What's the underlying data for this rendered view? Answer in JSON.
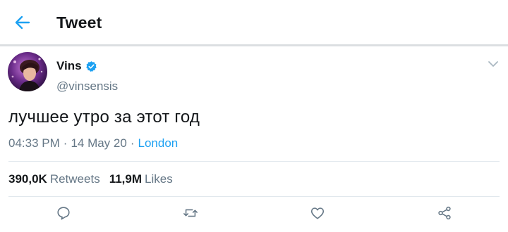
{
  "header": {
    "title": "Tweet",
    "back_icon": "arrow-left-icon",
    "accent_color": "#1da1f2"
  },
  "tweet": {
    "author": {
      "name": "Vins",
      "handle": "@vinsensis",
      "verified": true
    },
    "text": "лучшее утро за этот год",
    "time": "04:33 PM",
    "separator": "·",
    "date": "14 May 20",
    "location": "London",
    "stats": {
      "retweets_count": "390,0K",
      "retweets_label": "Retweets",
      "likes_count": "11,9M",
      "likes_label": "Likes"
    }
  },
  "actions": [
    "reply-icon",
    "retweet-icon",
    "like-icon",
    "share-icon"
  ]
}
